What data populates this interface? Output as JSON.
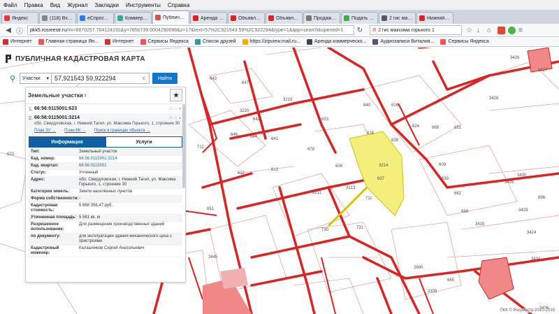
{
  "menubar": [
    "Файл",
    "Правка",
    "Вид",
    "Журнал",
    "Закладки",
    "Инструменты",
    "Справка"
  ],
  "tabs": [
    {
      "label": "Яндекс",
      "color": "#e33"
    },
    {
      "label": "(118) Входя...",
      "color": "#888"
    },
    {
      "label": "eСпросу ...",
      "color": "#2a7de1"
    },
    {
      "label": "Коммерче...",
      "color": "#3a9"
    },
    {
      "label": "Публичная ...",
      "color": "#c55",
      "active": true
    },
    {
      "label": "Аренда то...",
      "color": "#d22"
    },
    {
      "label": "Объявлен...",
      "color": "#d22"
    },
    {
      "label": "Объявлен...",
      "color": "#d22"
    },
    {
      "label": "Продажа з...",
      "color": "#777"
    },
    {
      "label": "Подать объ...",
      "color": "#4a4"
    },
    {
      "label": "2 гис макс...",
      "color": "#556"
    },
    {
      "label": "Нижний Т...",
      "color": "#d22"
    }
  ],
  "nav": {
    "url_host": "pkk5.rosreestr.ru",
    "url_rest": "/#x=6670257.704124192&y=7850739.0004290098&z=17&text=57%2C921543 59%2C922294&type=1&app=search&opened=1",
    "search_value": "2 гис максима горького 1"
  },
  "bookmarks": [
    {
      "label": "Интернет",
      "color": "#c33"
    },
    {
      "label": "Главная страница Ян...",
      "color": "#e55"
    },
    {
      "label": "Интернет",
      "color": "#c33"
    },
    {
      "label": "Сервисы Яндекса",
      "color": "#e55"
    },
    {
      "label": "Список друзей",
      "color": "#39a"
    },
    {
      "label": "https://zipview.mail.ru...",
      "color": "#fa0"
    },
    {
      "label": "Аренда коммерческо...",
      "color": "#444"
    },
    {
      "label": "Аудиозаписи Виталия...",
      "color": "#557"
    },
    {
      "label": "Сервисы Яндекса",
      "color": "#e55"
    }
  ],
  "app": {
    "title": "ПУБЛИЧНАЯ КАДАСТРОВАЯ КАРТА",
    "search_kind": "Участки",
    "search_value": "57,921543 59,922294",
    "find_label": "Найти"
  },
  "panel": {
    "heading": "Земельные участки",
    "count": "2",
    "results": [
      {
        "num": "1.",
        "cad": "66:56:0115001:623",
        "addr": ""
      },
      {
        "num": "2.",
        "cad": "66:56:0115001:3214",
        "addr": "обл. Свердловская, г. Нижний Тагил, ул. Максима Горького, 1, строение 30"
      }
    ],
    "links": [
      "План ЗУ →",
      "План КК →",
      "Поиск в границах объекта →"
    ],
    "tab_info": "Информация",
    "tab_services": "Услуги",
    "props": [
      {
        "k": "Тип:",
        "v": "Земельный участок",
        "link": false
      },
      {
        "k": "Кад. номер:",
        "v": "66:56:0115001:3214",
        "link": true
      },
      {
        "k": "Кад. квартал:",
        "v": "66:56:0115001",
        "link": true
      },
      {
        "k": "Статус:",
        "v": "Учтенный",
        "link": false
      },
      {
        "k": "Адрес:",
        "v": "обл. Свердловская, г. Нижний Тагил, ул. Максима Горького, 1, строение 30",
        "link": false
      },
      {
        "k": "Категория земель:",
        "v": "Земли населённых пунктов",
        "link": false
      },
      {
        "k": "Форма собственности:",
        "v": "-",
        "link": false
      },
      {
        "k": "Кадастровая стоимость:",
        "v": "5 868 356,47 руб.",
        "link": false
      },
      {
        "k": "Уточненная площадь:",
        "v": "5 561 кв. м",
        "link": false
      },
      {
        "k": "Разрешенное использование:",
        "v": "Для размещения производственных зданий",
        "link": false
      },
      {
        "k": "по документу:",
        "v": "для эксплуатации здания механического цеха с пристроями",
        "link": false
      },
      {
        "k": "Кадастровый инженер:",
        "v": "Калашников Сергей Анатольевич",
        "link": false
      }
    ]
  },
  "map": {
    "labels": [
      "643",
      "647",
      "3220",
      "3219",
      "642",
      "646",
      "644",
      "641",
      "640",
      "616",
      "623",
      "624",
      "668",
      "618",
      "638",
      "609",
      "678",
      "637",
      "3214",
      "608",
      "612",
      "613",
      "639",
      "662",
      "651",
      "623",
      "3211",
      "3213",
      "711",
      "731",
      "730",
      "665",
      "3445",
      "2680",
      "3339",
      "3426",
      "3427",
      "3428",
      "651",
      "3425",
      "3429",
      "3424",
      "3415",
      "3432",
      "3430",
      "668",
      "3436",
      "696",
      "712"
    ],
    "copyright": "ПКК © Росреестр 2010-2015"
  }
}
